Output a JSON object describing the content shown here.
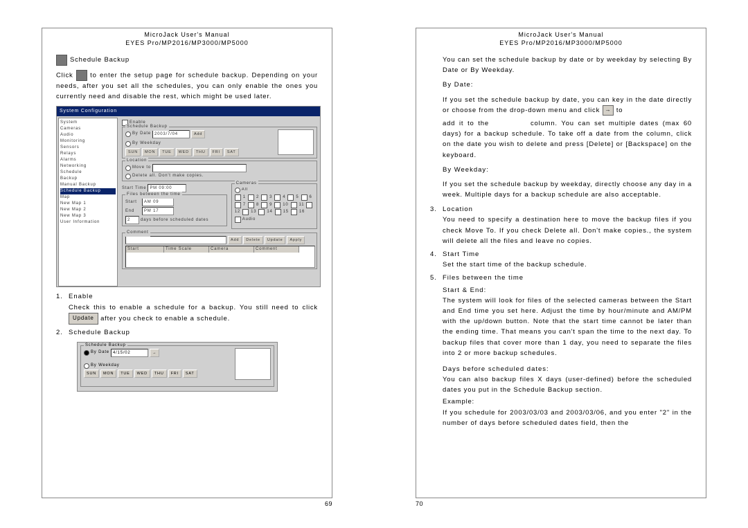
{
  "header1": "MicroJack User's Manual",
  "header2": "EYES Pro/MP2016/MP3000/MP5000",
  "left": {
    "section_title": "Schedule Backup",
    "intro1": "Click",
    "intro2": "to enter the setup page for schedule backup.  Depending on your needs, after you set all the schedules, you can only enable the ones you currently need and disable the rest, which might be used later.",
    "ss": {
      "title": "System Configuration",
      "tree": [
        "System",
        "Cameras",
        "Audio",
        "Monitoring",
        "Sensors",
        "Relays",
        "Alarms",
        "Networking",
        "Schedule",
        "Backup",
        "  Manual Backup",
        "  Schedule Backup",
        "Map",
        "  New Map 1",
        "  New Map 2",
        "  New Map 3",
        "User Information"
      ],
      "enable": "Enable",
      "grp_schedule": "Schedule Backup",
      "by_date": "By Date",
      "date_val": "2003/7/04",
      "add": "Add",
      "by_weekday": "By Weekday",
      "wk": [
        "SUN",
        "MON",
        "TUE",
        "WED",
        "THU",
        "FRI",
        "SAT"
      ],
      "grp_location": "Location",
      "move_to": "Move to",
      "delete_all": "Delete all. Don't make copies.",
      "start_time": "Start Time",
      "start_time_val": "PM 09:00",
      "grp_files": "Files between the time",
      "start": "Start",
      "start_val": "AM 09",
      "end": "End",
      "end_val": "PM 17",
      "days_before": "days before scheduled dates",
      "grp_cameras": "Cameras",
      "all": "All",
      "audio": "Audio",
      "grp_comment": "Comment",
      "btn_add": "Add",
      "th": [
        "Start",
        "Time Scale",
        "Camera",
        "Comment"
      ]
    },
    "item1_num": "1.",
    "item1_title": "Enable",
    "item1_body1": "Check this to enable a schedule for a backup.  You still need to click",
    "item1_update": "Update",
    "item1_body2": "after you check to enable a schedule.",
    "item2_num": "2.",
    "item2_title": "Schedule Backup",
    "small": {
      "grp": "Schedule Backup",
      "by_date": "By Date",
      "date": "4/15/02",
      "by_wk": "By Weekday",
      "wk": [
        "SUN",
        "MON",
        "TUE",
        "WED",
        "THU",
        "FRI",
        "SAT"
      ]
    },
    "pagenum": "69"
  },
  "right": {
    "p1": "You can set the schedule backup by date or by weekday by selecting By Date or By Weekday.",
    "bydate_t": "By Date:",
    "bydate_1": "If you set the schedule backup by date, you can key in the date directly or choose from the drop-down menu and click",
    "arrow": "→",
    "bydate_2": "to",
    "bydate_3a": "add it to the",
    "bydate_3b": "column.  You can set multiple dates (max 60 days) for a backup schedule.  To take off a date from the column, click on the date you wish to delete and press [Delete] or [Backspace] on the keyboard.",
    "bywk_t": "By Weekday:",
    "bywk_b": "If you set the schedule backup by weekday, directly choose any day in a week.  Multiple days for a backup schedule are also acceptable.",
    "i3n": "3.",
    "i3t": "Location",
    "i3b": "You need to specify a destination here to move the backup files if you check Move To.  If you check Delete all. Don't make copies., the system will delete all the files and leave no copies.",
    "i4n": "4.",
    "i4t": "Start Time",
    "i4b": "Set the start time of the backup schedule.",
    "i5n": "5.",
    "i5t": "Files between the time",
    "i5_se": "Start & End:",
    "i5_seb": "The system will look for files of the selected cameras between the Start and End time you set here. Adjust the time by hour/minute and AM/PM with the up/down button.  Note that the start time cannot be later than the ending time. That means you can't span the time to the next day. To backup files that cover more than 1 day, you need to separate the files into 2 or more backup schedules.",
    "i5_days_t": "Days before scheduled dates:",
    "i5_days_b": "You can also backup files X days (user-defined) before the scheduled dates you put in the Schedule Backup section.",
    "i5_ex_t": "Example:",
    "i5_ex_b": "If you schedule for 2003/03/03 and 2003/03/06, and you enter \"2\" in the number of days before scheduled dates field, then the",
    "pagenum": "70"
  }
}
